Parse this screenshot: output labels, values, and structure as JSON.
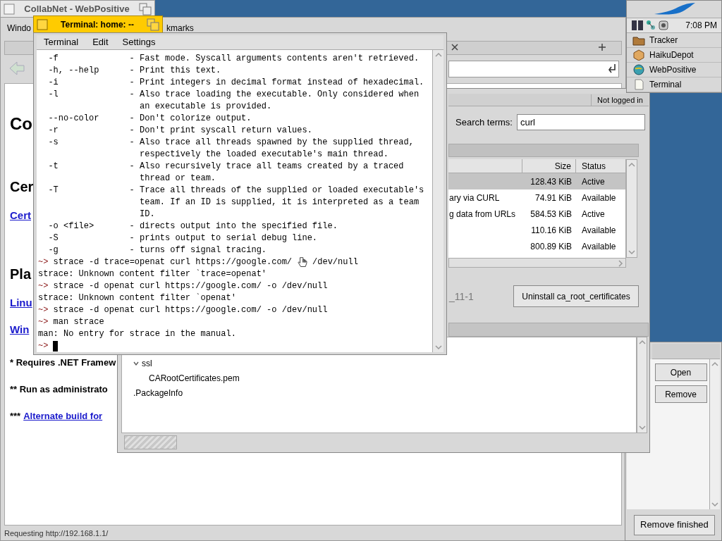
{
  "deskbar": {
    "clock": "7:08 PM",
    "items": [
      {
        "label": "Tracker",
        "kind": "tracker"
      },
      {
        "label": "HaikuDepot",
        "kind": "depot"
      },
      {
        "label": "WebPositive",
        "kind": "web"
      },
      {
        "label": "Terminal",
        "kind": "terminal"
      }
    ]
  },
  "browser": {
    "title": "CollabNet - WebPositive",
    "menu": [
      "Windo",
      "kmarks"
    ],
    "status": "Requesting http://192.168.1.1/",
    "content": [
      {
        "kind": "h1",
        "text": "Co"
      },
      {
        "kind": "h2",
        "text": "Cer"
      },
      {
        "kind": "link",
        "text": "Cert"
      },
      {
        "kind": "h2",
        "text": "Pla"
      },
      {
        "kind": "link",
        "text": "Linu"
      },
      {
        "kind": "link",
        "text": "Win"
      },
      {
        "kind": "note",
        "text": "* Requires .NET Framew"
      },
      {
        "kind": "note",
        "text": "** Run as administrato"
      },
      {
        "kind": "note",
        "prefix": "***",
        "text": "Alternate build for"
      }
    ]
  },
  "package_manager": {
    "login": "Not logged in",
    "search_label": "Search terms:",
    "search_value": "curl",
    "columns": [
      "Size",
      "Status"
    ],
    "rows": [
      {
        "name": "",
        "size": "128.43 KiB",
        "status": "Active",
        "selected": true
      },
      {
        "name": "ary via CURL",
        "size": "74.91 KiB",
        "status": "Available",
        "selected": false
      },
      {
        "name": "g data from URLs",
        "size": "584.53 KiB",
        "status": "Active",
        "selected": false
      },
      {
        "name": "",
        "size": "110.16 KiB",
        "status": "Available",
        "selected": false
      },
      {
        "name": "",
        "size": "800.89 KiB",
        "status": "Available",
        "selected": false
      }
    ],
    "version": "_11-1",
    "uninstall": "Uninstall ca_root_certificates",
    "files": [
      {
        "name": "ssl",
        "expanded": true,
        "children": [
          {
            "name": "CARootCertificates.pem"
          }
        ]
      },
      {
        "name": ".PackageInfo"
      }
    ]
  },
  "terminal": {
    "title": "Terminal: home: --",
    "menu": [
      "Terminal",
      "Edit",
      "Settings"
    ],
    "lines": [
      {
        "kind": "output",
        "text": "  -f              - Fast mode. Syscall arguments contents aren't retrieved."
      },
      {
        "kind": "output",
        "text": "  -h, --help      - Print this text."
      },
      {
        "kind": "output",
        "text": "  -i              - Print integers in decimal format instead of hexadecimal."
      },
      {
        "kind": "output",
        "text": "  -l              - Also trace loading the executable. Only considered when"
      },
      {
        "kind": "output",
        "text": "                    an executable is provided."
      },
      {
        "kind": "output",
        "text": "  --no-color      - Don't colorize output."
      },
      {
        "kind": "output",
        "text": "  -r              - Don't print syscall return values."
      },
      {
        "kind": "output",
        "text": "  -s              - Also trace all threads spawned by the supplied thread,"
      },
      {
        "kind": "output",
        "text": "                    respectively the loaded executable's main thread."
      },
      {
        "kind": "output",
        "text": "  -t              - Also recursively trace all teams created by a traced"
      },
      {
        "kind": "output",
        "text": "                    thread or team."
      },
      {
        "kind": "output",
        "text": "  -T              - Trace all threads of the supplied or loaded executable's"
      },
      {
        "kind": "output",
        "text": "                    team. If an ID is supplied, it is interpreted as a team"
      },
      {
        "kind": "output",
        "text": "                    ID."
      },
      {
        "kind": "output",
        "text": "  -o <file>       - directs output into the specified file."
      },
      {
        "kind": "output",
        "text": "  -S              - prints output to serial debug line."
      },
      {
        "kind": "output",
        "text": "  -g              - turns off signal tracing."
      },
      {
        "kind": "prompt",
        "prompt": "~>",
        "text": " strace -d trace=openat curl https://google.com/",
        "after": "/dev/null",
        "pointer": true
      },
      {
        "kind": "output",
        "text": "strace: Unknown content filter `trace=openat'"
      },
      {
        "kind": "prompt",
        "prompt": "~>",
        "text": " strace -d openat curl https://google.com/ -o /dev/null"
      },
      {
        "kind": "output",
        "text": "strace: Unknown content filter `openat'"
      },
      {
        "kind": "prompt",
        "prompt": "~>",
        "text": " strace -d openat curl https://google.com/ -o /dev/null"
      },
      {
        "kind": "prompt",
        "prompt": "~>",
        "text": " man strace"
      },
      {
        "kind": "output",
        "text": "man: No entry for strace in the manual."
      },
      {
        "kind": "prompt",
        "prompt": "~>",
        "cursor": true
      }
    ]
  },
  "downloads": {
    "buttons": [
      "Open",
      "Remove"
    ],
    "remove_finished": "Remove finished"
  }
}
